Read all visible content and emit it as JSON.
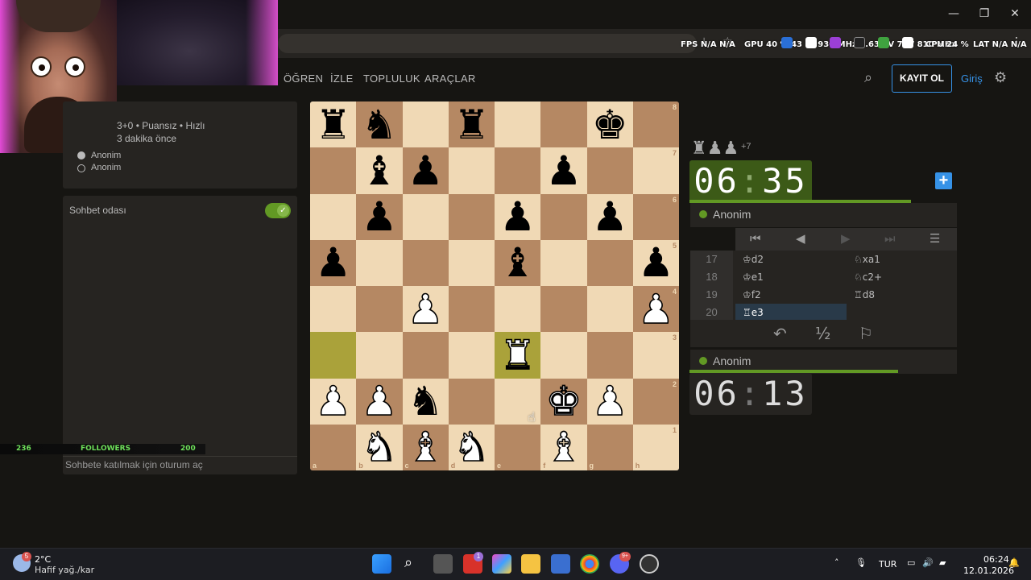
{
  "browser": {
    "window_controls": {
      "minimize": "—",
      "restore": "❐",
      "close": "✕"
    },
    "overlay": {
      "fps_label": "FPS",
      "fps_value": "N/A",
      "fps_value2": "N/A",
      "gpu_label": "GPU",
      "gpu_load": "40 %",
      "gpu_temp": "43 °C",
      "gpu_clock": "930 MHz",
      "gpu_volt": "0.635 V",
      "gpu_power": "7 W",
      "mem_clock": "810 MHz",
      "cpu_label": "CPU",
      "cpu_load": "24 %",
      "lat_label": "LAT",
      "lat_value": "N/A",
      "lat_value2": "N/A"
    }
  },
  "site": {
    "nav": [
      "ÖĞREN",
      "İZLE",
      "TOPLULUK",
      "ARAÇLAR"
    ],
    "register_label": "KAYIT OL",
    "login_label": "Giriş"
  },
  "game_info": {
    "settings": "3+0 • Puansız • Hızlı",
    "time_ago": "3 dakika önce",
    "players": [
      "Anonim",
      "Anonim"
    ]
  },
  "chat": {
    "title": "Sohbet odası",
    "placeholder": "Sohbete katılmak için oturum aç",
    "enabled": true
  },
  "stream_overlay": {
    "left_count": "236",
    "label": "FOLLOWERS",
    "right_count": "200"
  },
  "board": {
    "ranks": [
      "8",
      "7",
      "6",
      "5",
      "4",
      "3",
      "2",
      "1"
    ],
    "files": [
      "a",
      "b",
      "c",
      "d",
      "e",
      "f",
      "g",
      "h"
    ],
    "rows": [
      [
        "r",
        "n",
        "",
        "r",
        "",
        "",
        "k",
        ""
      ],
      [
        "",
        "b",
        "p",
        "",
        "",
        "p",
        "",
        ""
      ],
      [
        "",
        "p",
        "",
        "",
        "p",
        "",
        "p",
        ""
      ],
      [
        "p",
        "",
        "",
        "",
        "b",
        "",
        "",
        "p"
      ],
      [
        "",
        "",
        "P",
        "",
        "",
        "",
        "",
        "P"
      ],
      [
        "",
        "",
        "",
        "",
        "R",
        "",
        "",
        ""
      ],
      [
        "P",
        "P",
        "n",
        "",
        "",
        "K",
        "P",
        ""
      ],
      [
        "",
        "N",
        "B",
        "N",
        "",
        "B",
        "",
        ""
      ]
    ],
    "last_move_squares": [
      "a3",
      "e3"
    ]
  },
  "captured": {
    "pieces": "♜♟♟",
    "advantage": "+7"
  },
  "clocks": {
    "opponent": {
      "min": "06",
      "sec": "35"
    },
    "player": {
      "min": "06",
      "sec": "13"
    }
  },
  "players": {
    "top": "Anonim",
    "bottom": "Anonim"
  },
  "controls": {
    "first": "⏮",
    "prev": "◀",
    "next": "▶",
    "last": "⏭",
    "menu": "☰"
  },
  "moves": [
    {
      "num": "17",
      "white": "♔d2",
      "black": "♘xa1"
    },
    {
      "num": "18",
      "white": "♔e1",
      "black": "♘c2+"
    },
    {
      "num": "19",
      "white": "♔f2",
      "black": "♖d8"
    },
    {
      "num": "20",
      "white": "♖e3",
      "black": ""
    }
  ],
  "actions": {
    "takeback": "↶",
    "draw": "½",
    "resign": "⚐"
  },
  "taskbar": {
    "weather_temp": "2°C",
    "weather_desc": "Hafif yağ./kar",
    "weather_badge": "5",
    "lang": "TUR",
    "time": "06:24",
    "date": "12.01.2026",
    "lichess_badge": "1",
    "discord_badge": "9+"
  }
}
